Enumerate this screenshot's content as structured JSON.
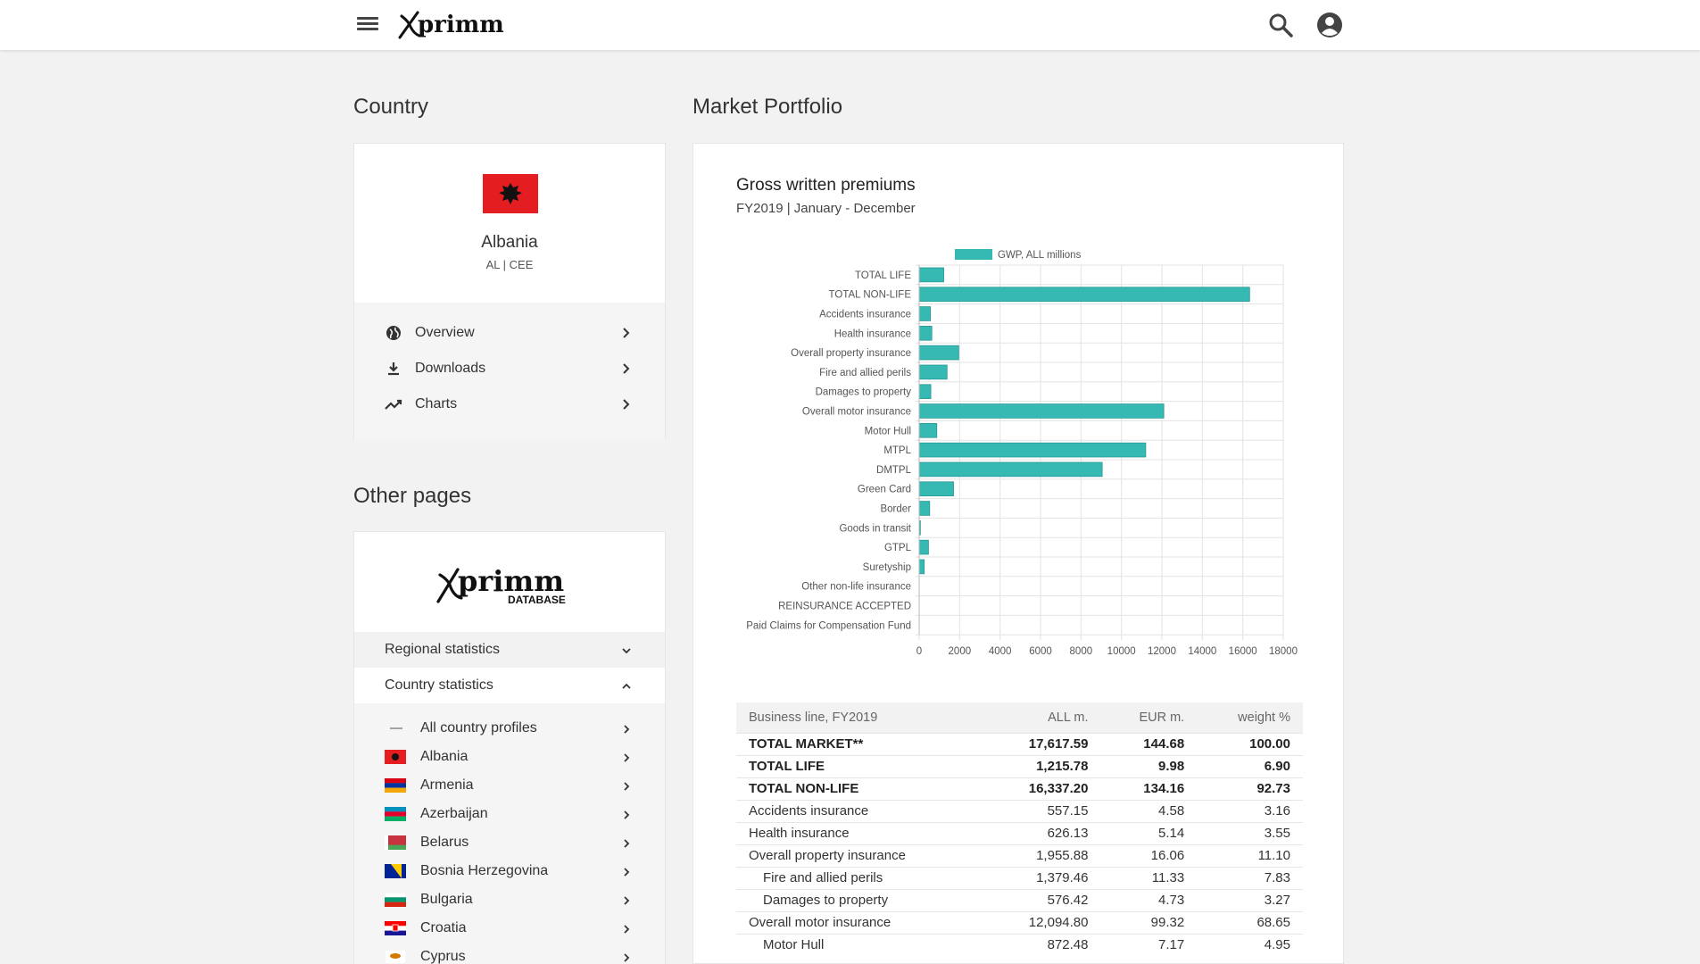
{
  "header": {
    "logo_text": "xprimm",
    "colors": {
      "accent": "#36b8b3",
      "albania_red": "#e41e20"
    }
  },
  "sidebar": {
    "country_title": "Country",
    "country": {
      "name": "Albania",
      "sub": "AL | CEE"
    },
    "nav": [
      {
        "label": "Overview",
        "icon": "globe-icon"
      },
      {
        "label": "Downloads",
        "icon": "download-icon"
      },
      {
        "label": "Charts",
        "icon": "trending-icon"
      }
    ],
    "other_title": "Other pages",
    "db_logo": {
      "main": "xprimm",
      "sub": "DATABASE"
    },
    "regional": "Regional statistics",
    "country_stats": "Country statistics",
    "countries": [
      {
        "label": "All country profiles",
        "flag": "dash"
      },
      {
        "label": "Albania",
        "flag": "albania"
      },
      {
        "label": "Armenia",
        "flag": "armenia"
      },
      {
        "label": "Azerbaijan",
        "flag": "azerbaijan"
      },
      {
        "label": "Belarus",
        "flag": "belarus"
      },
      {
        "label": "Bosnia Herzegovina",
        "flag": "bosnia"
      },
      {
        "label": "Bulgaria",
        "flag": "bulgaria"
      },
      {
        "label": "Croatia",
        "flag": "croatia"
      },
      {
        "label": "Cyprus",
        "flag": "cyprus"
      }
    ]
  },
  "main": {
    "title": "Market Portfolio",
    "chart_title": "Gross written premiums",
    "chart_subtitle": "FY2019 | January - December",
    "table": {
      "headers": [
        "Business line, FY2019",
        "ALL m.",
        "EUR m.",
        "weight %"
      ],
      "rows": [
        {
          "cells": [
            "TOTAL MARKET**",
            "17,617.59",
            "144.68",
            "100.00"
          ],
          "style": "bold"
        },
        {
          "cells": [
            "TOTAL LIFE",
            "1,215.78",
            "9.98",
            "6.90"
          ],
          "style": "bold"
        },
        {
          "cells": [
            "TOTAL NON-LIFE",
            "16,337.20",
            "134.16",
            "92.73"
          ],
          "style": "bold"
        },
        {
          "cells": [
            "Accidents insurance",
            "557.15",
            "4.58",
            "3.16"
          ],
          "style": ""
        },
        {
          "cells": [
            "Health insurance",
            "626.13",
            "5.14",
            "3.55"
          ],
          "style": ""
        },
        {
          "cells": [
            "Overall property insurance",
            "1,955.88",
            "16.06",
            "11.10"
          ],
          "style": ""
        },
        {
          "cells": [
            "Fire and allied perils",
            "1,379.46",
            "11.33",
            "7.83"
          ],
          "style": "sub"
        },
        {
          "cells": [
            "Damages to property",
            "576.42",
            "4.73",
            "3.27"
          ],
          "style": "sub"
        },
        {
          "cells": [
            "Overall motor insurance",
            "12,094.80",
            "99.32",
            "68.65"
          ],
          "style": ""
        },
        {
          "cells": [
            "Motor Hull",
            "872.48",
            "7.17",
            "4.95"
          ],
          "style": "sub"
        }
      ]
    }
  },
  "chart_data": {
    "type": "bar",
    "orientation": "horizontal",
    "categories": [
      "TOTAL LIFE",
      "TOTAL NON-LIFE",
      "Accidents insurance",
      "Health insurance",
      "Overall property insurance",
      "Fire and allied perils",
      "Damages to property",
      "Overall motor insurance",
      "Motor Hull",
      "MTPL",
      "DMTPL",
      "Green Card",
      "Border",
      "Goods in transit",
      "GTPL",
      "Suretyship",
      "Other non-life insurance",
      "REINSURANCE ACCEPTED",
      "Paid Claims for Compensation Fund"
    ],
    "series": [
      {
        "name": "GWP, ALL millions",
        "values": [
          1215.78,
          16337.2,
          557.15,
          626.13,
          1955.88,
          1379.46,
          576.42,
          12094.8,
          872.48,
          11200,
          9050,
          1700,
          520,
          60,
          460,
          250,
          0,
          0,
          0
        ]
      }
    ],
    "xlim": [
      0,
      18000
    ],
    "xticks": [
      0,
      2000,
      4000,
      6000,
      8000,
      10000,
      12000,
      14000,
      16000,
      18000
    ],
    "grid": true,
    "legend_position": "top",
    "color": "#36b8b3"
  }
}
